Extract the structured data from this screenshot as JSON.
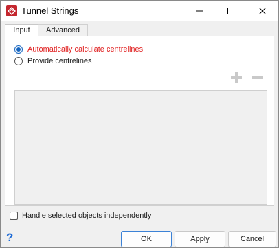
{
  "window": {
    "title": "Tunnel Strings",
    "app_icon": "app-logo-icon",
    "controls": {
      "minimize": "minimize-icon",
      "maximize": "maximize-icon",
      "close": "close-icon"
    }
  },
  "tabs": [
    {
      "label": "Input",
      "active": true
    },
    {
      "label": "Advanced",
      "active": false
    }
  ],
  "options": {
    "auto_label": "Automatically calculate centrelines",
    "auto_checked": true,
    "provide_label": "Provide centrelines",
    "provide_checked": false
  },
  "list_toolbar": {
    "add_icon": "plus-icon",
    "remove_icon": "minus-icon"
  },
  "handle_independently": {
    "label": "Handle selected objects independently",
    "checked": false
  },
  "footer": {
    "help_icon": "?",
    "ok_label": "OK",
    "apply_label": "Apply",
    "cancel_label": "Cancel"
  },
  "colors": {
    "accent": "#1565c0",
    "warning_text": "#e02020",
    "help": "#1e6bd6",
    "app_icon": "#c4262e"
  }
}
